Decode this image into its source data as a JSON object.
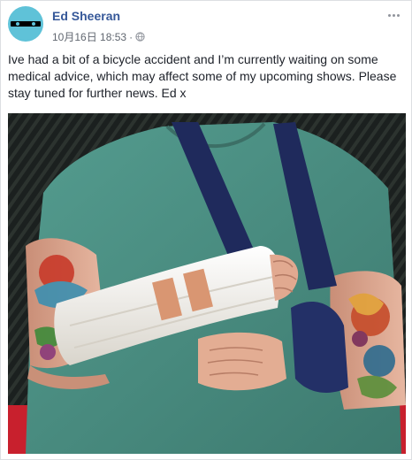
{
  "post": {
    "author": "Ed Sheeran",
    "timestamp": "10月16日 18:53",
    "separator": "·",
    "privacy_icon": "globe-icon",
    "more_icon": "more-options-icon",
    "text": "Ive had a bit of a bicycle accident and I’m currently waiting on some medical advice, which may affect some of my upcoming shows. Please stay tuned for further news. Ed x"
  },
  "colors": {
    "author_link": "#365899",
    "meta_text": "#616770",
    "body_text": "#1d2129",
    "avatar_bg": "#5fc2d8",
    "shirt": "#4a8f82",
    "sling": "#1f2a5c",
    "cast": "#f3f1ec",
    "red_bar": "#d0202e"
  }
}
